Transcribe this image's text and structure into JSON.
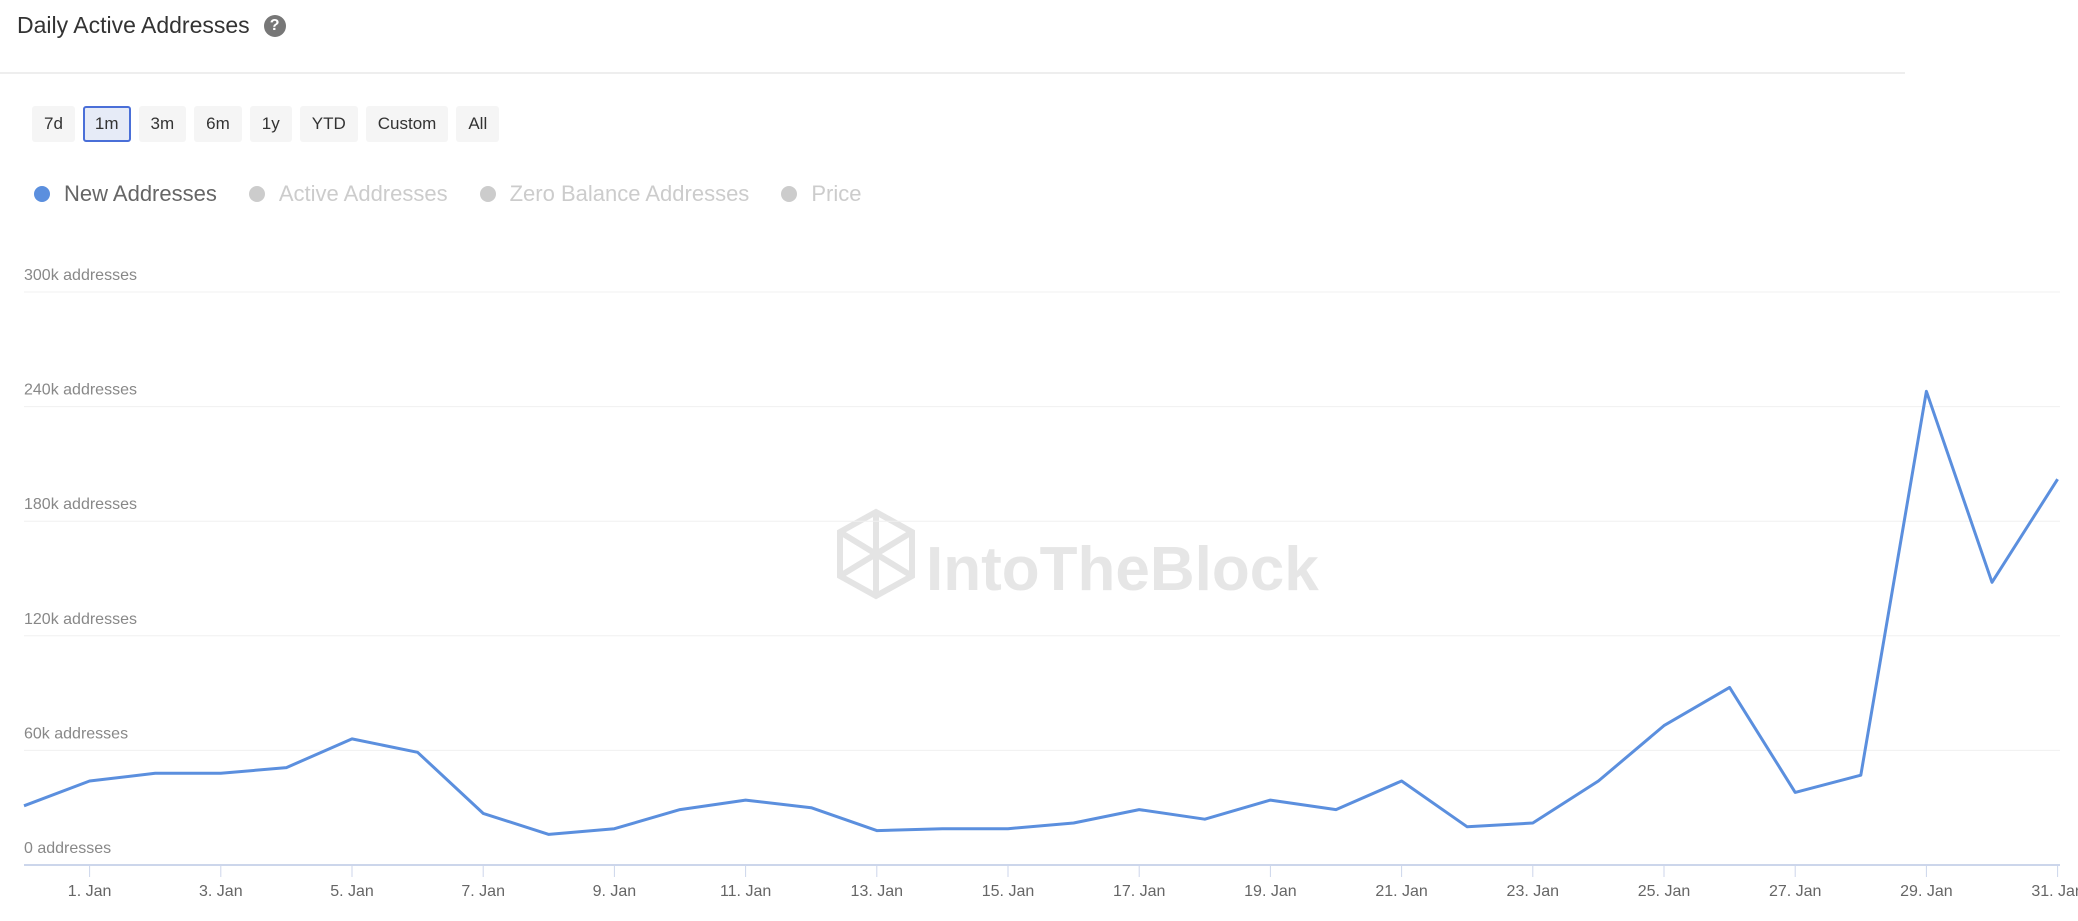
{
  "header": {
    "title": "Daily Active Addresses",
    "help_icon": "question-circle-icon"
  },
  "range_buttons": [
    {
      "label": "7d"
    },
    {
      "label": "1m",
      "active": true
    },
    {
      "label": "3m"
    },
    {
      "label": "6m"
    },
    {
      "label": "1y"
    },
    {
      "label": "YTD"
    },
    {
      "label": "Custom"
    },
    {
      "label": "All"
    }
  ],
  "watermark": "IntoTheBlock",
  "chart_data": {
    "type": "line",
    "title": "",
    "xlabel": "",
    "ylabel": "",
    "legend": [
      {
        "name": "New Addresses",
        "color": "#5b8fde",
        "active": true
      },
      {
        "name": "Active Addresses",
        "color": "#cccccc",
        "active": false
      },
      {
        "name": "Zero Balance Addresses",
        "color": "#cccccc",
        "active": false
      },
      {
        "name": "Price",
        "color": "#cccccc",
        "active": false
      }
    ],
    "legend_position": "top-left",
    "ylim": [
      0,
      300000
    ],
    "y_ticks": [
      0,
      60000,
      120000,
      180000,
      240000,
      300000
    ],
    "y_tick_labels": [
      "0 addresses",
      "60k addresses",
      "120k addresses",
      "180k addresses",
      "240k addresses",
      "300k addresses"
    ],
    "x_tick_labels": [
      "1. Jan",
      "3. Jan",
      "5. Jan",
      "7. Jan",
      "9. Jan",
      "11. Jan",
      "13. Jan",
      "15. Jan",
      "17. Jan",
      "19. Jan",
      "21. Jan",
      "23. Jan",
      "25. Jan",
      "27. Jan",
      "29. Jan",
      "31. Jan"
    ],
    "x": [
      "31. Dec",
      "1. Jan",
      "2. Jan",
      "3. Jan",
      "4. Jan",
      "5. Jan",
      "6. Jan",
      "7. Jan",
      "8. Jan",
      "9. Jan",
      "10. Jan",
      "11. Jan",
      "12. Jan",
      "13. Jan",
      "14. Jan",
      "15. Jan",
      "16. Jan",
      "17. Jan",
      "18. Jan",
      "19. Jan",
      "20. Jan",
      "21. Jan",
      "22. Jan",
      "23. Jan",
      "24. Jan",
      "25. Jan",
      "26. Jan",
      "27. Jan",
      "28. Jan",
      "29. Jan",
      "30. Jan",
      "31. Jan"
    ],
    "grid": true,
    "series": [
      {
        "name": "New Addresses",
        "color": "#5b8fde",
        "values": [
          31000,
          44000,
          48000,
          48000,
          51000,
          66000,
          59000,
          27000,
          16000,
          19000,
          29000,
          34000,
          30000,
          18000,
          19000,
          19000,
          22000,
          29000,
          24000,
          34000,
          29000,
          44000,
          20000,
          22000,
          44000,
          73000,
          93000,
          38000,
          47000,
          248000,
          148000,
          202000
        ]
      }
    ]
  }
}
